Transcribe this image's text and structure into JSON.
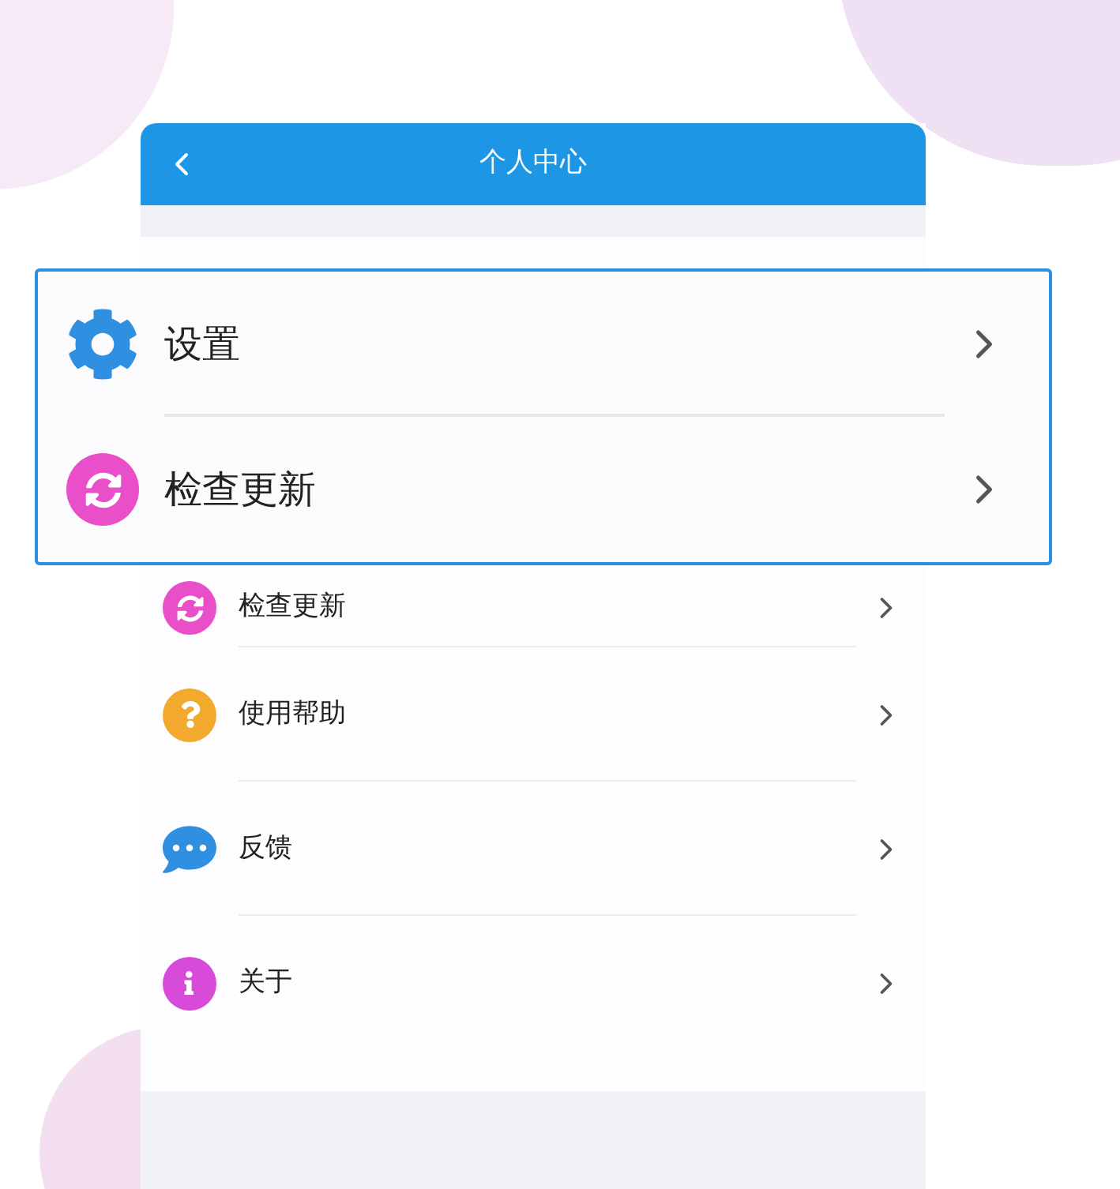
{
  "header": {
    "title": "个人中心"
  },
  "menu": [
    {
      "label": "检查更新",
      "kind": "update"
    },
    {
      "label": "使用帮助",
      "kind": "help"
    },
    {
      "label": "反馈",
      "kind": "feedback"
    },
    {
      "label": "关于",
      "kind": "about"
    }
  ],
  "magnified": [
    {
      "label": "设置",
      "kind": "settings"
    },
    {
      "label": "检查更新",
      "kind": "update"
    }
  ]
}
